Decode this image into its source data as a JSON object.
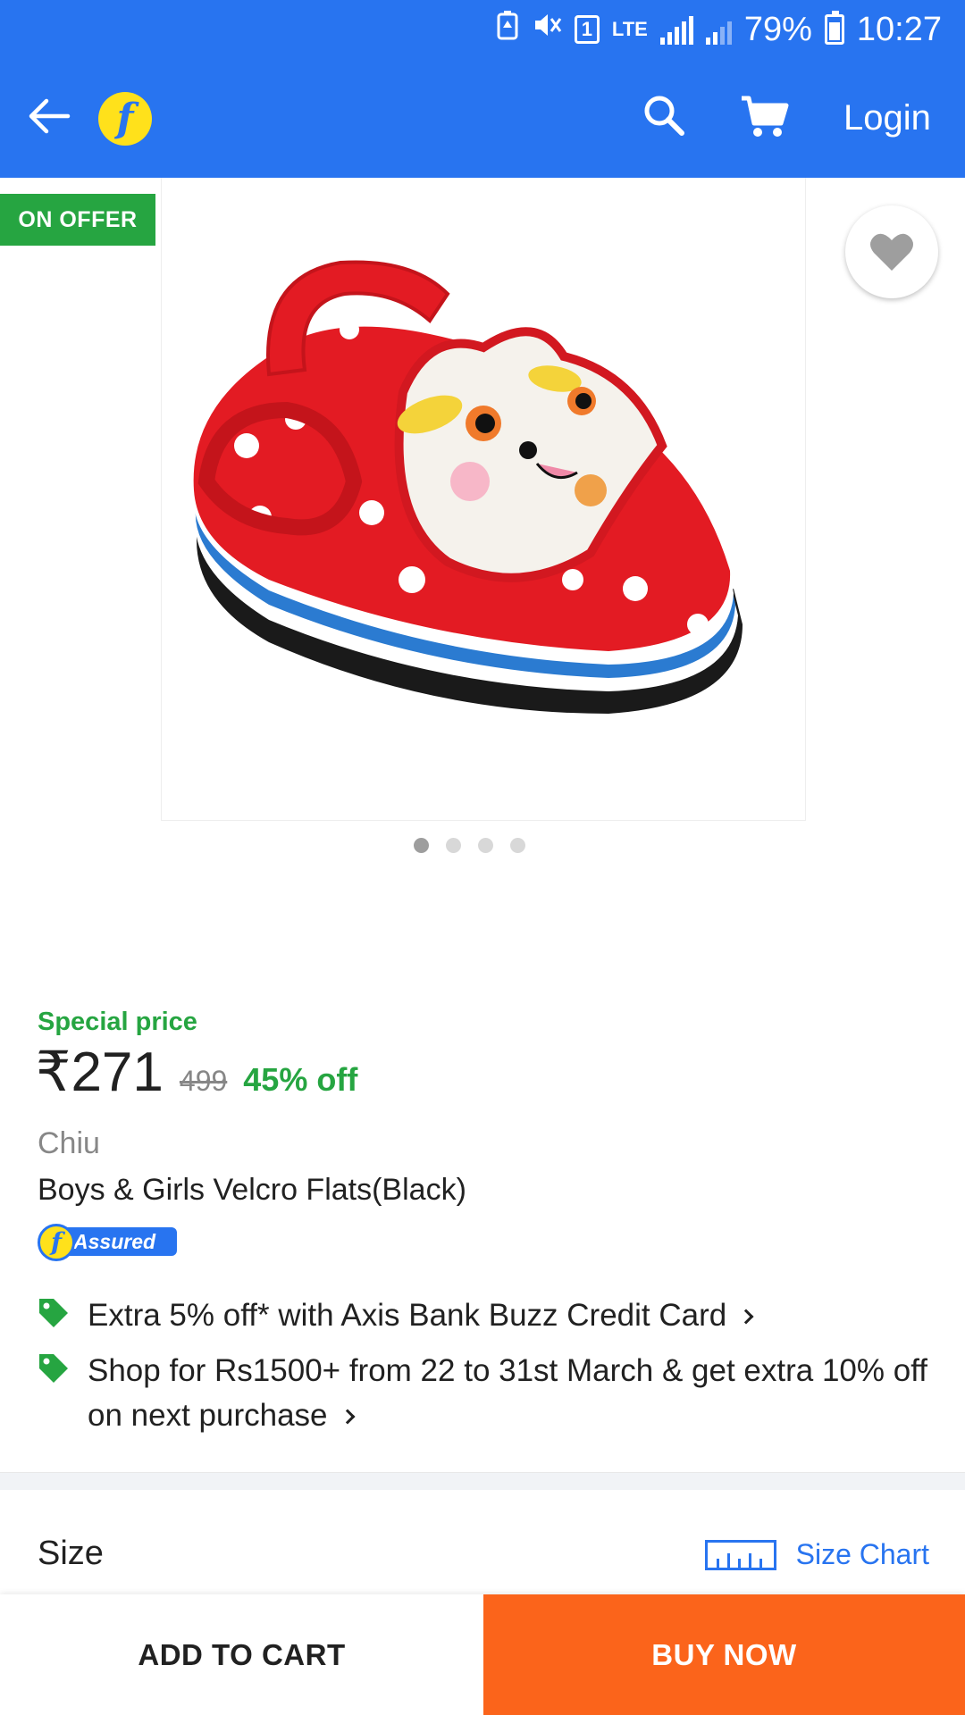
{
  "status_bar": {
    "sim_slot": "1",
    "network": "LTE",
    "battery": "79%",
    "time": "10:27"
  },
  "app_bar": {
    "logo_letter": "f",
    "login_label": "Login"
  },
  "product": {
    "offer_badge": "ON OFFER",
    "image_count": 4,
    "active_image_index": 0,
    "special_label": "Special price",
    "price": "₹271",
    "mrp": "499",
    "discount": "45% off",
    "brand": "Chiu",
    "title": "Boys & Girls Velcro Flats(Black)",
    "assured_label": "Assured"
  },
  "offers": [
    {
      "text": "Extra 5% off* with Axis Bank Buzz Credit Card"
    },
    {
      "text": "Shop for Rs1500+ from 22 to 31st March & get extra 10% off on next purchase"
    }
  ],
  "size_section": {
    "label": "Size",
    "size_chart_label": "Size Chart"
  },
  "actions": {
    "add_to_cart": "ADD TO CART",
    "buy_now": "BUY NOW"
  },
  "colors": {
    "brand_blue": "#2874f0",
    "offer_green": "#26a541",
    "buy_orange": "#fb641b",
    "logo_yellow": "#ffe11b"
  }
}
